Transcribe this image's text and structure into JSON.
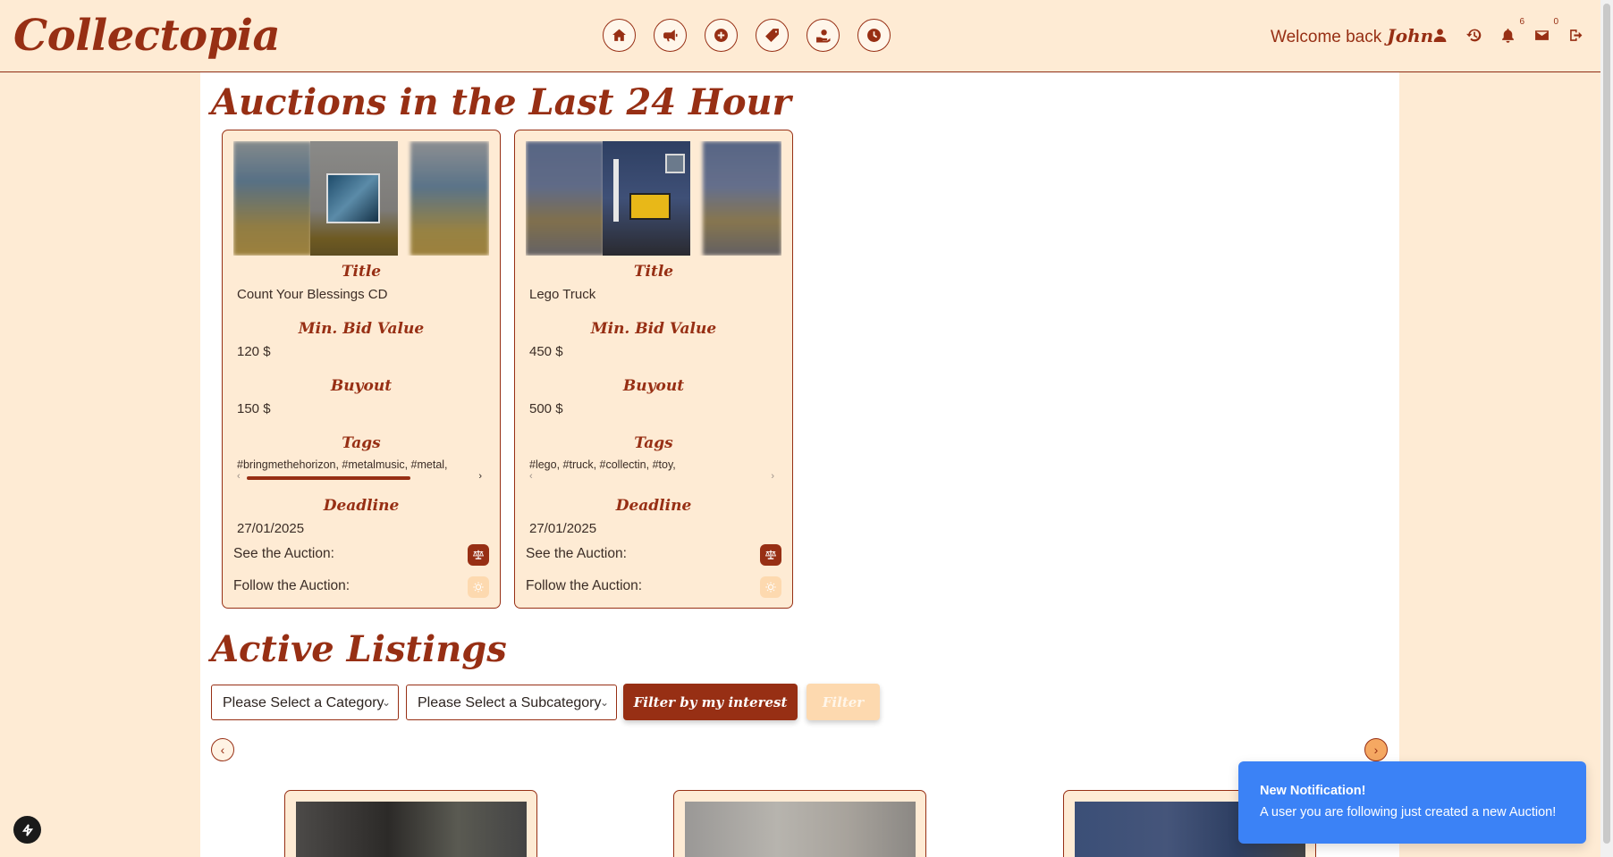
{
  "app": {
    "logo": "Collectopia"
  },
  "header": {
    "nav_icons": [
      "home-icon",
      "megaphone-icon",
      "plus-circle-icon",
      "tag-icon",
      "hand-coin-icon",
      "clock-coin-icon"
    ],
    "welcome_text": "Welcome back",
    "user_name": "John",
    "notifications_count": "6",
    "messages_count": "0"
  },
  "recent": {
    "title": "Auctions in the Last 24 Hour",
    "labels": {
      "title": "Title",
      "min_bid": "Min. Bid Value",
      "buyout": "Buyout",
      "tags": "Tags",
      "deadline": "Deadline",
      "see": "See the Auction:",
      "follow": "Follow the Auction:"
    },
    "cards": [
      {
        "title": "Count Your Blessings CD",
        "min_bid": "120 $",
        "buyout": "150 $",
        "tags": "#bringmethehorizon, #metalmusic, #metal,",
        "deadline": "27/01/2025"
      },
      {
        "title": "Lego Truck",
        "min_bid": "450 $",
        "buyout": "500 $",
        "tags": "#lego, #truck, #collectin, #toy,",
        "deadline": "27/01/2025"
      }
    ]
  },
  "listings": {
    "title": "Active Listings",
    "category_select": "Please Select a Category",
    "subcategory_select": "Please Select a Subcategory",
    "interest_button": "Filter by my interest",
    "filter_button": "Filter"
  },
  "toast": {
    "title": "New Notification!",
    "message": "A user you are following just created a new Auction!"
  },
  "colors": {
    "brand": "#972f14",
    "background": "#feebd4",
    "toast": "#3b82f6"
  }
}
